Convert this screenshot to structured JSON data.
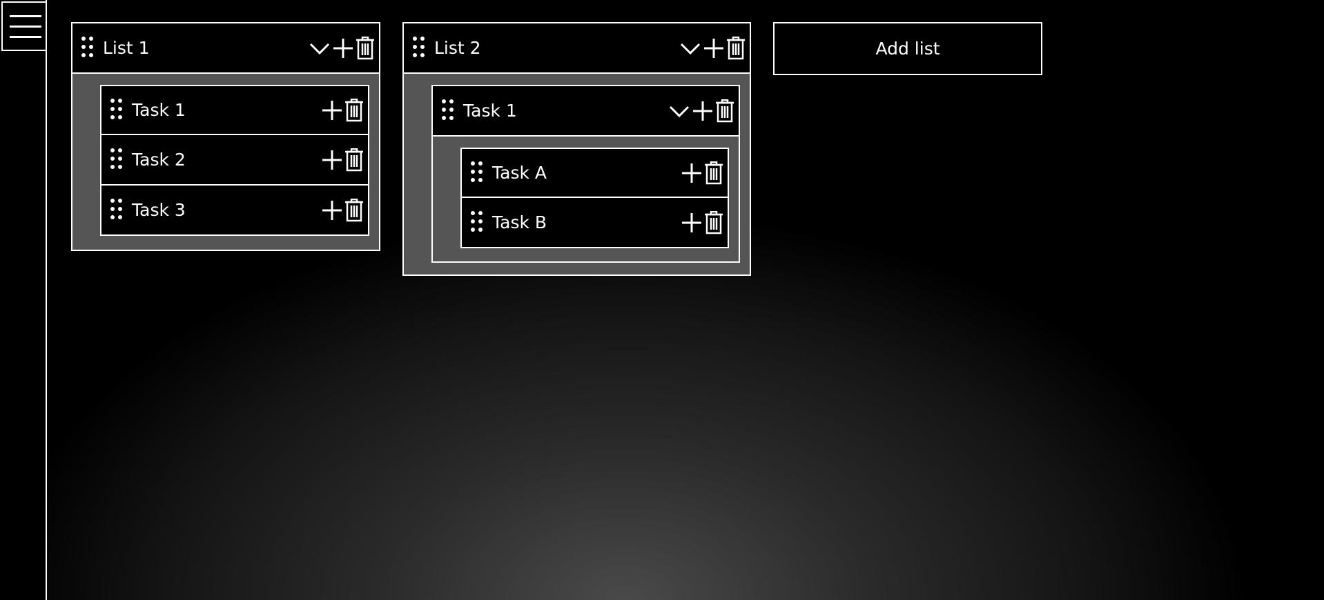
{
  "sidebar": {
    "menu_icon": "hamburger-menu-icon"
  },
  "lists": [
    {
      "title": "List 1",
      "tasks": [
        {
          "label": "Task 1"
        },
        {
          "label": "Task 2"
        },
        {
          "label": "Task 3"
        }
      ]
    },
    {
      "title": "List 2",
      "tasks": [
        {
          "label": "Task 1",
          "subtasks": [
            {
              "label": "Task A"
            },
            {
              "label": "Task B"
            }
          ]
        }
      ]
    }
  ],
  "add_list_label": "Add list",
  "icons": {
    "drag": "drag-handle-icon",
    "collapse": "chevron-down-icon",
    "add": "plus-icon",
    "delete": "trash-icon"
  },
  "colors": {
    "background": "#000000",
    "border": "#ffffff",
    "nested_area": "#555555",
    "text": "#ffffff"
  }
}
